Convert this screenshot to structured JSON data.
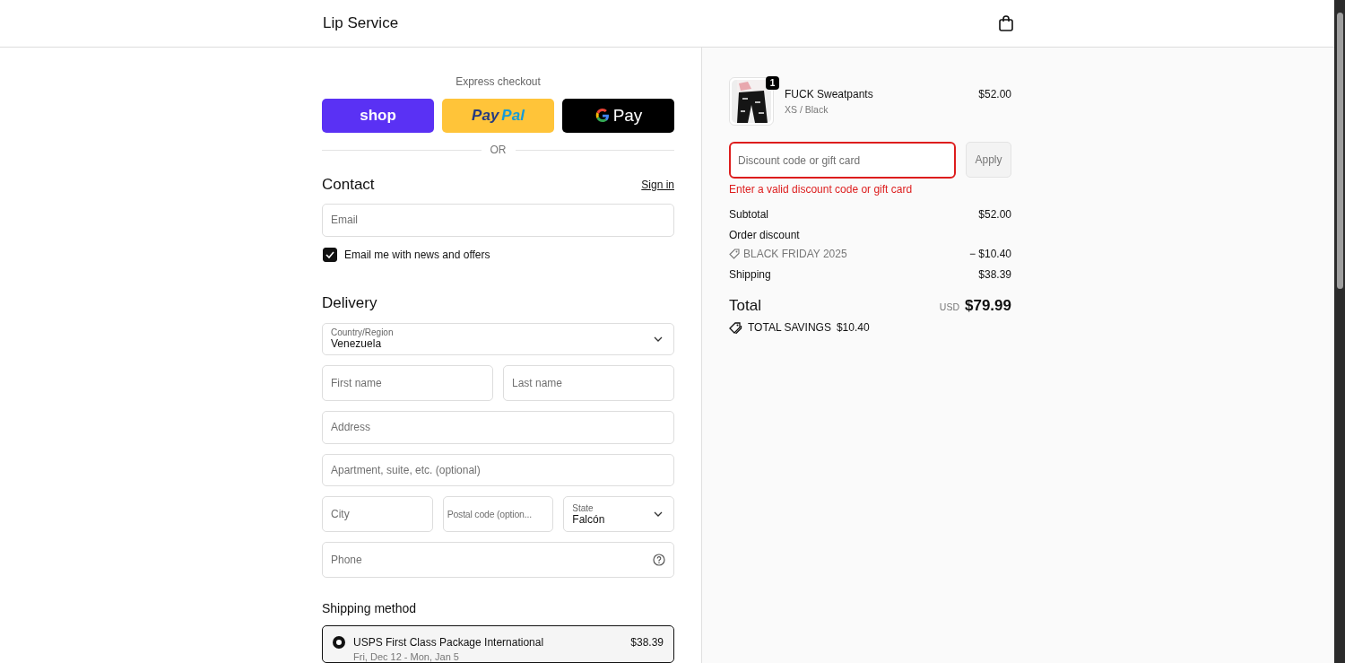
{
  "header": {
    "store_name": "Lip Service"
  },
  "express": {
    "title": "Express checkout",
    "buttons": [
      {
        "kind": "shop",
        "label": "shop"
      },
      {
        "kind": "paypal",
        "label": "Pay",
        "label2": "Pal"
      },
      {
        "kind": "gpay",
        "label": "Pay"
      }
    ],
    "divider": "OR"
  },
  "contact": {
    "title": "Contact",
    "sign_in": "Sign in",
    "email": {
      "placeholder": "Email"
    },
    "newsletter": {
      "label": "Email me with news and offers",
      "checked": true
    }
  },
  "delivery": {
    "title": "Delivery",
    "country": {
      "label": "Country/Region",
      "value": "Venezuela"
    },
    "fields": [
      {
        "placeholder": "First name"
      },
      {
        "placeholder": "Last name"
      }
    ],
    "address": {
      "placeholder": "Address"
    },
    "apartment": {
      "placeholder": "Apartment, suite, etc. (optional)"
    },
    "city": {
      "placeholder": "City"
    },
    "postal": {
      "placeholder": "Postal code (option..."
    },
    "state": {
      "label": "State",
      "value": "Falcón"
    },
    "phone": {
      "placeholder": "Phone"
    }
  },
  "shipping": {
    "title": "Shipping method",
    "options": [
      {
        "name": "USPS First Class Package International",
        "price": "$38.39",
        "dates": "Fri, Dec 12 - Mon, Jan 5",
        "selected": true
      }
    ]
  },
  "cart": {
    "items": [
      {
        "name": "FUCK Sweatpants",
        "variant": "XS / Black",
        "price": "$52.00",
        "quantity": "1"
      }
    ],
    "discount": {
      "placeholder": "Discount code or gift card",
      "button": "Apply",
      "error": "Enter a valid discount code or gift card"
    },
    "subtotal": {
      "label": "Subtotal",
      "value": "$52.00"
    },
    "order_discount": {
      "label": "Order discount",
      "code": "BLACK FRIDAY 2025",
      "value": "− $10.40"
    },
    "shipping": {
      "label": "Shipping",
      "value": "$38.39"
    },
    "total": {
      "label": "Total",
      "currency": "USD",
      "value": "$79.99"
    },
    "savings": {
      "label": "TOTAL SAVINGS",
      "value": "$10.40"
    }
  }
}
